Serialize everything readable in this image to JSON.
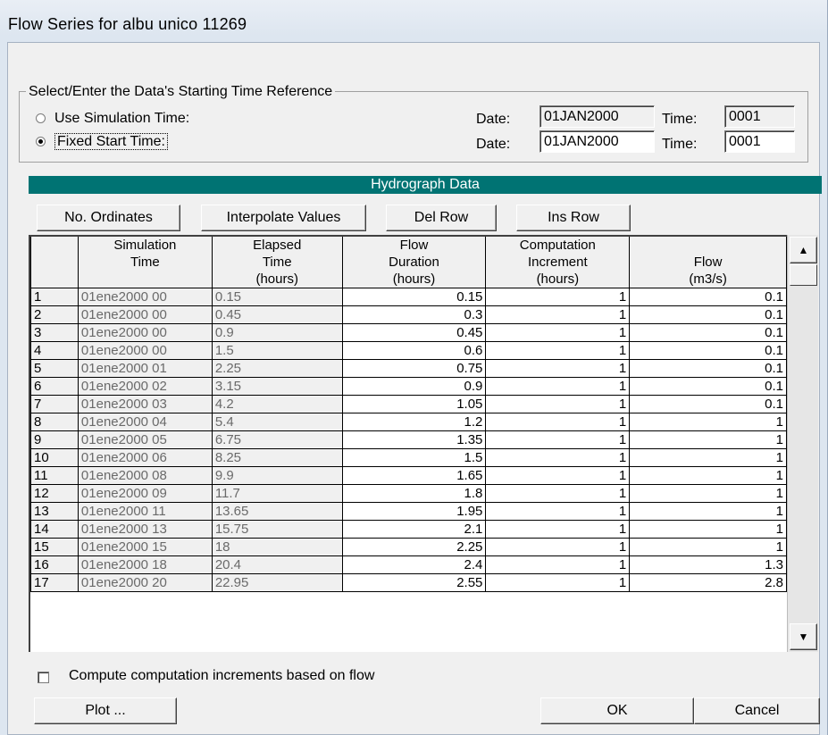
{
  "window": {
    "title": "Flow Series for albu unico 11269"
  },
  "time_reference": {
    "group_label": "Select/Enter the Data's Starting Time Reference",
    "use_simulation": {
      "label": "Use Simulation Time:",
      "date_label": "Date:",
      "date": "01JAN2000",
      "time_label": "Time:",
      "time": "0001",
      "selected": false
    },
    "fixed_start": {
      "label": "Fixed Start Time:",
      "date_label": "Date:",
      "date": "01JAN2000",
      "time_label": "Time:",
      "time": "0001",
      "selected": true
    }
  },
  "hydrograph": {
    "title": "Hydrograph Data",
    "buttons": {
      "no_ordinates": "No. Ordinates",
      "interpolate": "Interpolate Values",
      "del_row": "Del Row",
      "ins_row": "Ins Row"
    },
    "headers": [
      [
        "",
        "Simulation",
        "Elapsed",
        "Flow",
        "Computation",
        ""
      ],
      [
        "",
        "Time",
        "Time",
        "Duration",
        "Increment",
        "Flow"
      ],
      [
        "",
        "",
        "(hours)",
        "(hours)",
        "(hours)",
        "(m3/s)"
      ]
    ],
    "rows": [
      [
        "1",
        "01ene2000 00",
        "0.15",
        "0.15",
        "1",
        "0.1"
      ],
      [
        "2",
        "01ene2000 00",
        "0.45",
        "0.3",
        "1",
        "0.1"
      ],
      [
        "3",
        "01ene2000 00",
        "0.9",
        "0.45",
        "1",
        "0.1"
      ],
      [
        "4",
        "01ene2000 00",
        "1.5",
        "0.6",
        "1",
        "0.1"
      ],
      [
        "5",
        "01ene2000 01",
        "2.25",
        "0.75",
        "1",
        "0.1"
      ],
      [
        "6",
        "01ene2000 02",
        "3.15",
        "0.9",
        "1",
        "0.1"
      ],
      [
        "7",
        "01ene2000 03",
        "4.2",
        "1.05",
        "1",
        "0.1"
      ],
      [
        "8",
        "01ene2000 04",
        "5.4",
        "1.2",
        "1",
        "1"
      ],
      [
        "9",
        "01ene2000 05",
        "6.75",
        "1.35",
        "1",
        "1"
      ],
      [
        "10",
        "01ene2000 06",
        "8.25",
        "1.5",
        "1",
        "1"
      ],
      [
        "11",
        "01ene2000 08",
        "9.9",
        "1.65",
        "1",
        "1"
      ],
      [
        "12",
        "01ene2000 09",
        "11.7",
        "1.8",
        "1",
        "1"
      ],
      [
        "13",
        "01ene2000 11",
        "13.65",
        "1.95",
        "1",
        "1"
      ],
      [
        "14",
        "01ene2000 13",
        "15.75",
        "2.1",
        "1",
        "1"
      ],
      [
        "15",
        "01ene2000 15",
        "18",
        "2.25",
        "1",
        "1"
      ],
      [
        "16",
        "01ene2000 18",
        "20.4",
        "2.4",
        "1",
        "1.3"
      ],
      [
        "17",
        "01ene2000 20",
        "22.95",
        "2.55",
        "1",
        "2.8"
      ]
    ]
  },
  "compute_option": {
    "label": "Compute computation increments based on flow",
    "checked": false
  },
  "footer": {
    "plot": "Plot ...",
    "ok": "OK",
    "cancel": "Cancel"
  },
  "colors": {
    "header_bar": "#007373",
    "dialog_bg": "#f0f0f0"
  }
}
